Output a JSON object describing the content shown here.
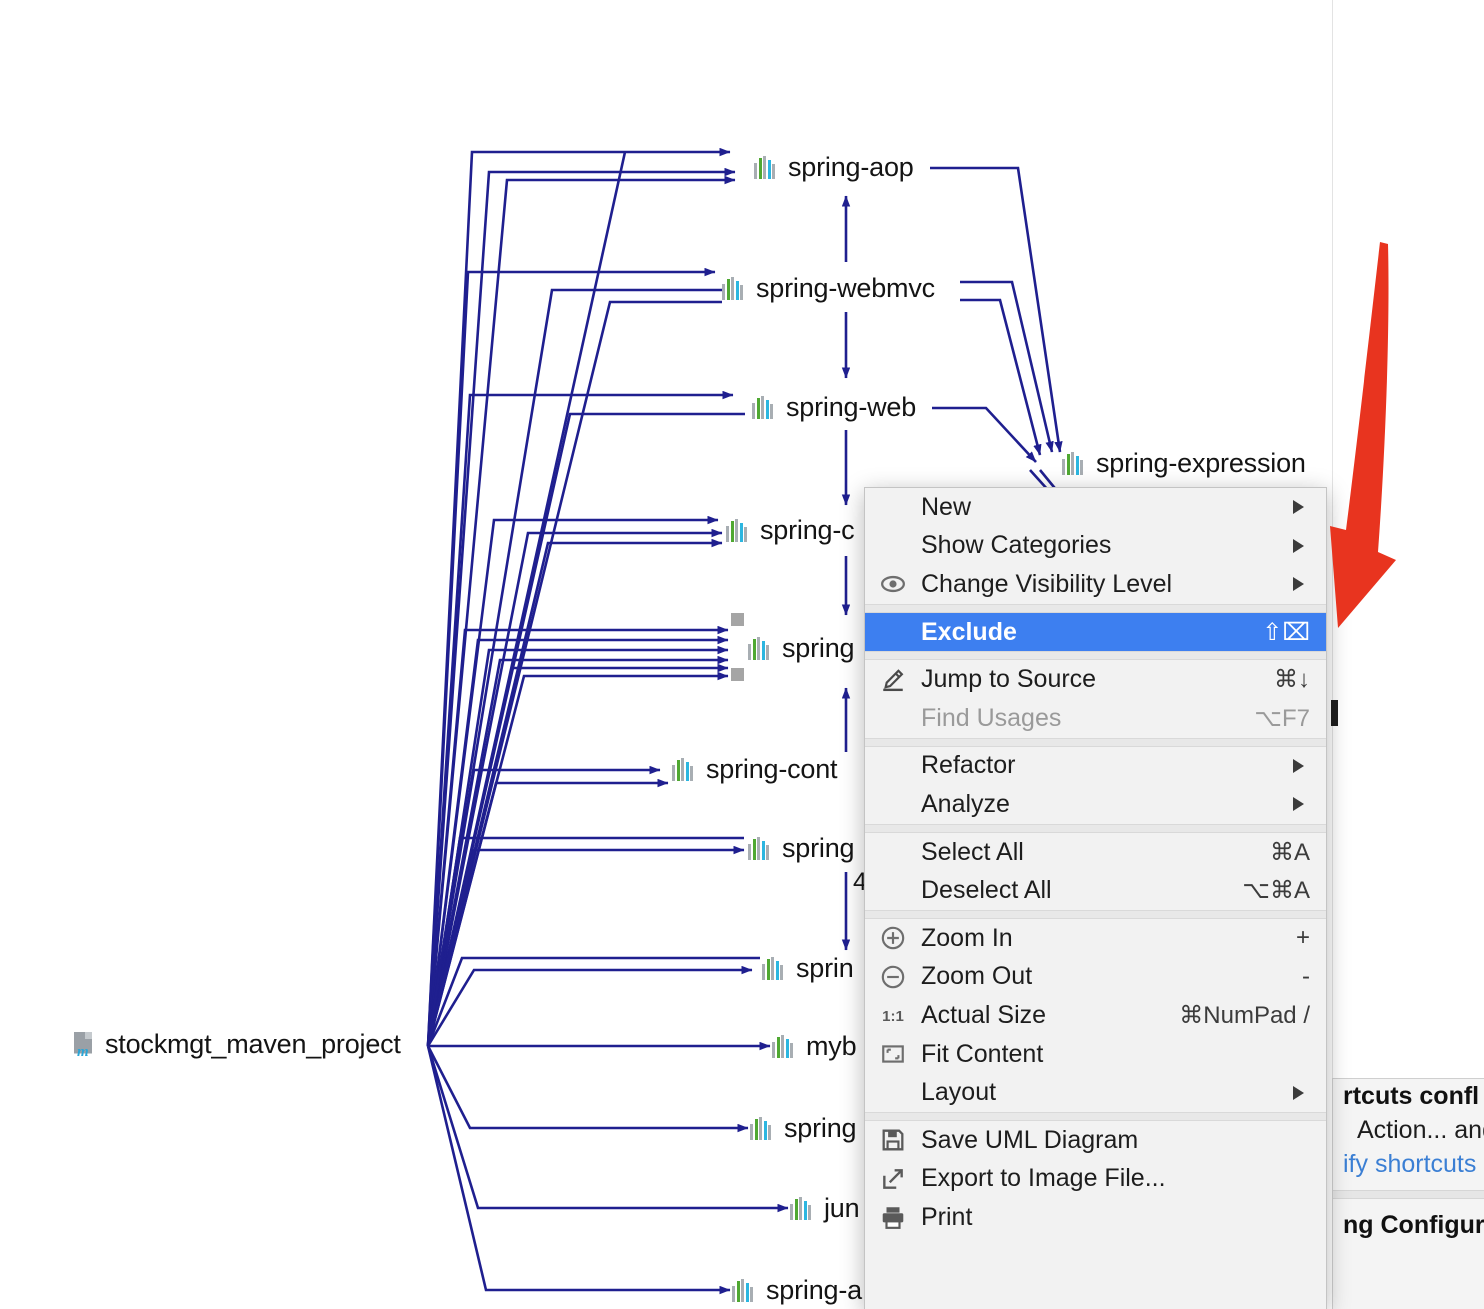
{
  "app": {
    "kind": "uml-dependency-diagram",
    "accent_blue": "#3d7ff0",
    "edge_color": "#1f1f8f",
    "annotation_color": "#e8341f"
  },
  "diagram": {
    "root": {
      "label": "stockmgt_maven_project",
      "icon": "maven-module-icon"
    },
    "nodes": [
      {
        "id": "spring-aop",
        "label": "spring-aop",
        "icon": "jar-icon",
        "selected": false
      },
      {
        "id": "spring-webmvc",
        "label": "spring-webmvc",
        "icon": "jar-icon",
        "selected": false
      },
      {
        "id": "spring-web",
        "label": "spring-web",
        "icon": "jar-icon",
        "selected": false
      },
      {
        "id": "spring-expression",
        "label": "spring-expression",
        "icon": "jar-icon",
        "selected": false
      },
      {
        "id": "spring-core",
        "label": "spring-c",
        "icon": "jar-icon",
        "selected": false
      },
      {
        "id": "spring-beans",
        "label": "spring",
        "icon": "jar-icon",
        "selected": true
      },
      {
        "id": "spring-context",
        "label": "spring-cont",
        "icon": "jar-icon",
        "selected": false
      },
      {
        "id": "spring-a",
        "label": "spring",
        "icon": "jar-icon",
        "selected": false
      },
      {
        "id": "spring-b",
        "label": "sprin",
        "icon": "jar-icon",
        "selected": false
      },
      {
        "id": "mybatis",
        "label": "myb",
        "icon": "jar-icon",
        "selected": false
      },
      {
        "id": "spring-c2",
        "label": "spring",
        "icon": "jar-icon",
        "selected": false
      },
      {
        "id": "junit",
        "label": "jun",
        "icon": "jar-icon",
        "selected": false
      },
      {
        "id": "spring-a2",
        "label": "spring-a",
        "icon": "jar-icon",
        "selected": false
      }
    ],
    "edge_labels": [
      "4"
    ]
  },
  "context_menu": {
    "groups": [
      {
        "items": [
          {
            "label": "New",
            "icon": null,
            "accel": "",
            "submenu": true,
            "disabled": false,
            "selected": false
          },
          {
            "label": "Show Categories",
            "icon": null,
            "accel": "",
            "submenu": true,
            "disabled": false,
            "selected": false
          },
          {
            "label": "Change Visibility Level",
            "icon": "eye-icon",
            "accel": "",
            "submenu": true,
            "disabled": false,
            "selected": false
          }
        ]
      },
      {
        "items": [
          {
            "label": "Exclude",
            "icon": null,
            "accel": "⇧⌧",
            "submenu": false,
            "disabled": false,
            "selected": true
          }
        ]
      },
      {
        "items": [
          {
            "label": "Jump to Source",
            "icon": "pencil-icon",
            "accel": "⌘↓",
            "submenu": false,
            "disabled": false,
            "selected": false
          },
          {
            "label": "Find Usages",
            "icon": null,
            "accel": "⌥F7",
            "submenu": false,
            "disabled": true,
            "selected": false
          }
        ]
      },
      {
        "items": [
          {
            "label": "Refactor",
            "icon": null,
            "accel": "",
            "submenu": true,
            "disabled": false,
            "selected": false
          },
          {
            "label": "Analyze",
            "icon": null,
            "accel": "",
            "submenu": true,
            "disabled": false,
            "selected": false
          }
        ]
      },
      {
        "items": [
          {
            "label": "Select All",
            "icon": null,
            "accel": "⌘A",
            "submenu": false,
            "disabled": false,
            "selected": false
          },
          {
            "label": "Deselect All",
            "icon": null,
            "accel": "⌥⌘A",
            "submenu": false,
            "disabled": false,
            "selected": false
          }
        ]
      },
      {
        "items": [
          {
            "label": "Zoom In",
            "icon": "zoom-in-icon",
            "accel": "+",
            "submenu": false,
            "disabled": false,
            "selected": false
          },
          {
            "label": "Zoom Out",
            "icon": "zoom-out-icon",
            "accel": "-",
            "submenu": false,
            "disabled": false,
            "selected": false
          },
          {
            "label": "Actual Size",
            "icon": "actual-size-icon",
            "accel": "⌘NumPad /",
            "submenu": false,
            "disabled": false,
            "selected": false
          },
          {
            "label": "Fit Content",
            "icon": "fit-content-icon",
            "accel": "",
            "submenu": false,
            "disabled": false,
            "selected": false
          },
          {
            "label": "Layout",
            "icon": null,
            "accel": "",
            "submenu": true,
            "disabled": false,
            "selected": false
          }
        ]
      },
      {
        "items": [
          {
            "label": "Save UML Diagram",
            "icon": "save-icon",
            "accel": "",
            "submenu": false,
            "disabled": false,
            "selected": false
          },
          {
            "label": "Export to Image File...",
            "icon": "export-icon",
            "accel": "",
            "submenu": false,
            "disabled": false,
            "selected": false
          },
          {
            "label": "Print",
            "icon": "print-icon",
            "accel": "",
            "submenu": false,
            "disabled": false,
            "selected": false
          }
        ]
      }
    ]
  },
  "notification": {
    "title": "rtcuts confl",
    "body": "Action... and",
    "link": "ify shortcuts",
    "second_title": "ng Configur"
  }
}
